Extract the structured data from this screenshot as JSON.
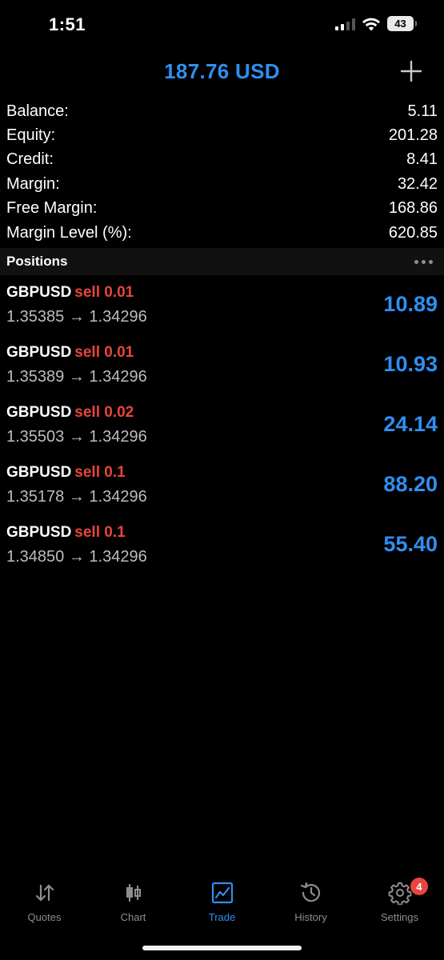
{
  "status_bar": {
    "time": "1:51",
    "battery": "43"
  },
  "header": {
    "amount": "187.76 USD"
  },
  "summary": [
    {
      "label": "Balance:",
      "value": "5.11"
    },
    {
      "label": "Equity:",
      "value": "201.28"
    },
    {
      "label": "Credit:",
      "value": "8.41"
    },
    {
      "label": "Margin:",
      "value": "32.42"
    },
    {
      "label": "Free Margin:",
      "value": "168.86"
    },
    {
      "label": "Margin Level (%):",
      "value": "620.85"
    }
  ],
  "positions": {
    "title": "Positions",
    "items": [
      {
        "symbol": "GBPUSD",
        "side": "sell 0.01",
        "prices": "1.35385 → 1.34296",
        "profit": "10.89"
      },
      {
        "symbol": "GBPUSD",
        "side": "sell 0.01",
        "prices": "1.35389 → 1.34296",
        "profit": "10.93"
      },
      {
        "symbol": "GBPUSD",
        "side": "sell 0.02",
        "prices": "1.35503 → 1.34296",
        "profit": "24.14"
      },
      {
        "symbol": "GBPUSD",
        "side": "sell 0.1",
        "prices": "1.35178 → 1.34296",
        "profit": "88.20"
      },
      {
        "symbol": "GBPUSD",
        "side": "sell 0.1",
        "prices": "1.34850 → 1.34296",
        "profit": "55.40"
      }
    ]
  },
  "tabs": [
    {
      "label": "Quotes",
      "icon": "quotes-icon"
    },
    {
      "label": "Chart",
      "icon": "chart-icon"
    },
    {
      "label": "Trade",
      "icon": "trade-icon",
      "active": true
    },
    {
      "label": "History",
      "icon": "history-icon"
    },
    {
      "label": "Settings",
      "icon": "settings-icon",
      "badge": "4"
    }
  ],
  "colors": {
    "accent": "#2f8ff0",
    "sell": "#e8453c",
    "inactive": "#8e8e93"
  }
}
